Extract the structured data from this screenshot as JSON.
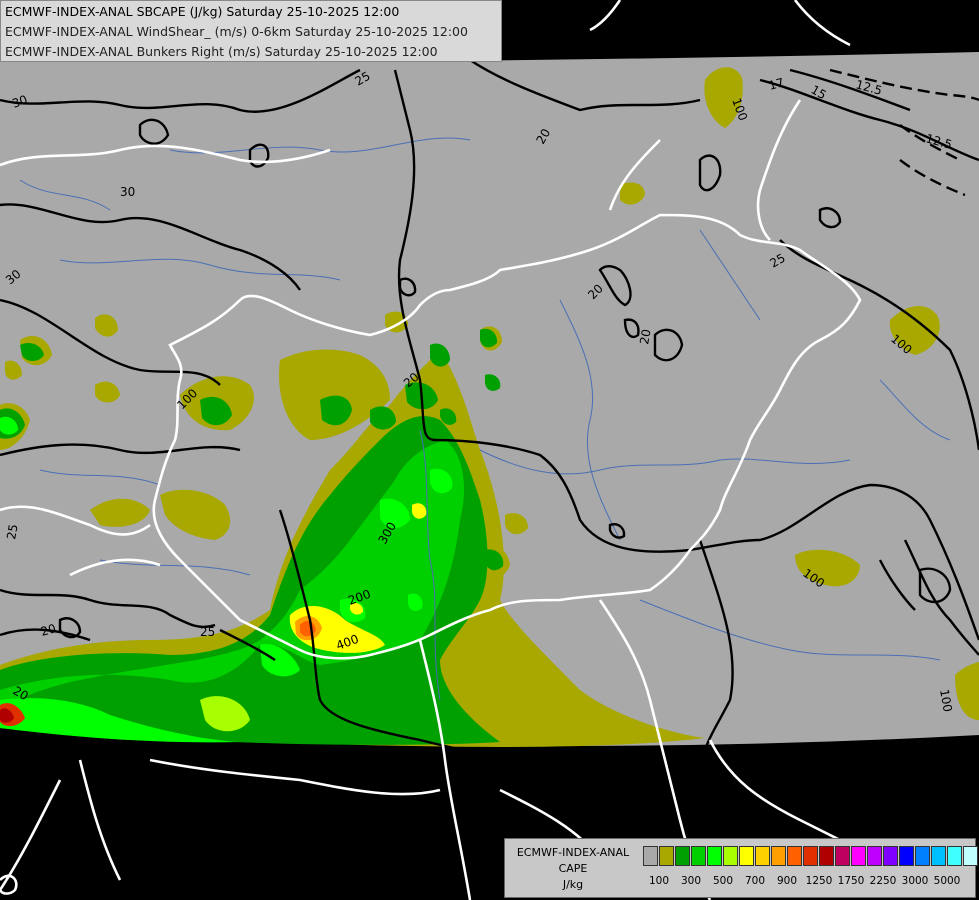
{
  "header": {
    "line1": "ECMWF-INDEX-ANAL SBCAPE (J/kg) Saturday 25-10-2025 12:00",
    "line2": "ECMWF-INDEX-ANAL WindShear_ (m/s) 0-6km Saturday 25-10-2025 12:00",
    "line3": "ECMWF-INDEX-ANAL Bunkers Right (m/s) Saturday 25-10-2025 12:00"
  },
  "legend": {
    "title1": "ECMWF-INDEX-ANAL",
    "title2": "CAPE",
    "title3": "J/kg",
    "colors": [
      "#a9a9a9",
      "#a8a800",
      "#00a000",
      "#00d000",
      "#00ff00",
      "#a8ff00",
      "#ffff00",
      "#ffd000",
      "#ffa000",
      "#ff6000",
      "#e03000",
      "#b00000",
      "#c00060",
      "#ff00ff",
      "#c000ff",
      "#8000ff",
      "#0000ff",
      "#0080ff",
      "#00c0ff",
      "#40ffff",
      "#c0ffff",
      "#ffffff"
    ],
    "ticks": [
      "100",
      "300",
      "500",
      "700",
      "900",
      "1250",
      "1750",
      "2250",
      "3000",
      "5000"
    ]
  },
  "map": {
    "contour_labels": [
      {
        "text": "25",
        "kind": "shear"
      },
      {
        "text": "30",
        "kind": "shear"
      },
      {
        "text": "30",
        "kind": "shear"
      },
      {
        "text": "30",
        "kind": "shear"
      },
      {
        "text": "20",
        "kind": "shear"
      },
      {
        "text": "20",
        "kind": "shear"
      },
      {
        "text": "20",
        "kind": "shear"
      },
      {
        "text": "20",
        "kind": "shear"
      },
      {
        "text": "25",
        "kind": "shear"
      },
      {
        "text": "25",
        "kind": "shear"
      },
      {
        "text": "25",
        "kind": "shear"
      },
      {
        "text": "20",
        "kind": "shear"
      },
      {
        "text": "17",
        "kind": "shear"
      },
      {
        "text": "15",
        "kind": "shear"
      },
      {
        "text": "12.5",
        "kind": "bunkers"
      },
      {
        "text": "12.5",
        "kind": "bunkers"
      },
      {
        "text": "100",
        "kind": "cape"
      },
      {
        "text": "100",
        "kind": "cape"
      },
      {
        "text": "100",
        "kind": "cape"
      },
      {
        "text": "100",
        "kind": "cape"
      },
      {
        "text": "100",
        "kind": "cape"
      },
      {
        "text": "300",
        "kind": "cape"
      },
      {
        "text": "200",
        "kind": "cape"
      },
      {
        "text": "400",
        "kind": "cape"
      },
      {
        "text": "20",
        "kind": "shear"
      }
    ]
  }
}
